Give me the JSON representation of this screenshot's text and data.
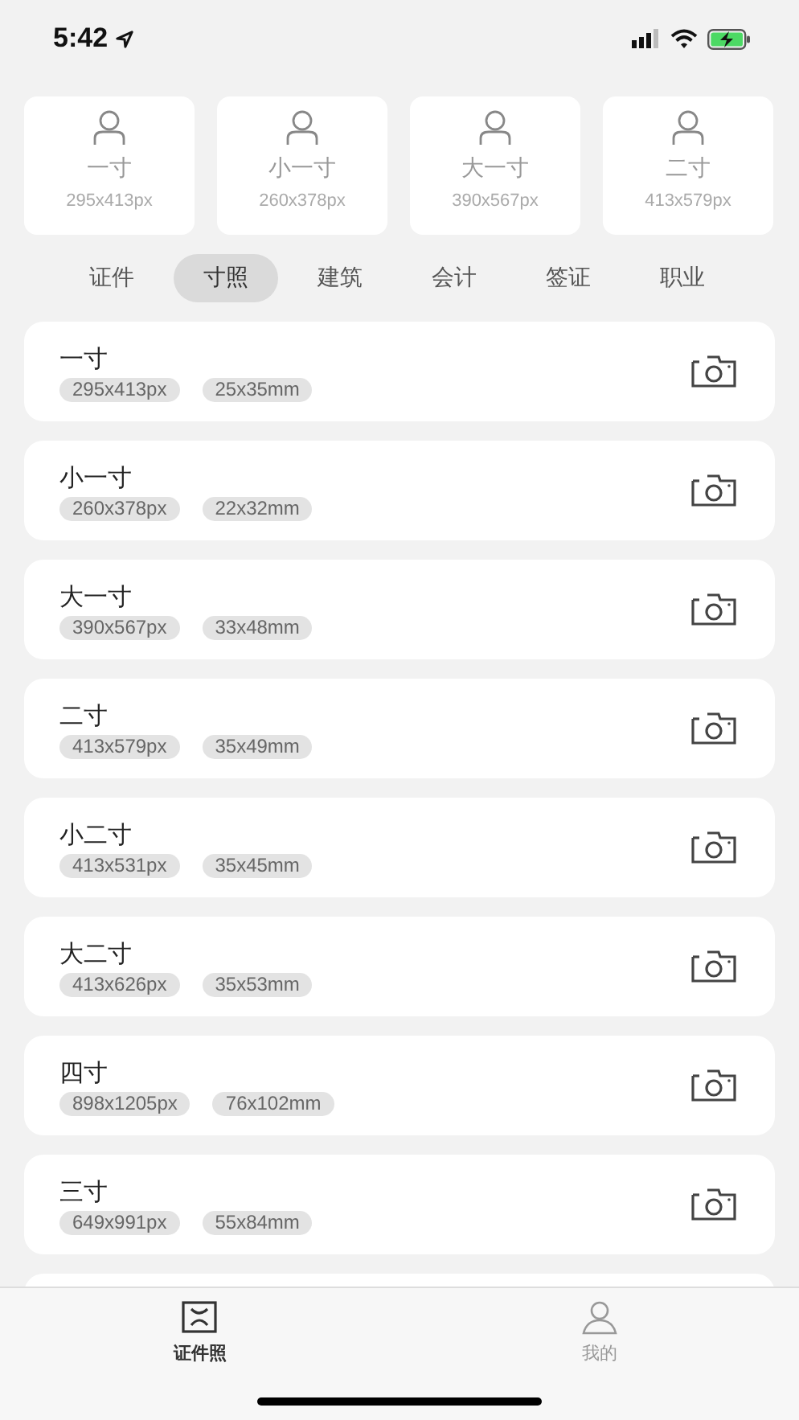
{
  "status_bar": {
    "time": "5:42"
  },
  "featured": [
    {
      "name": "一寸",
      "pixels": "295x413px"
    },
    {
      "name": "小一寸",
      "pixels": "260x378px"
    },
    {
      "name": "大一寸",
      "pixels": "390x567px"
    },
    {
      "name": "二寸",
      "pixels": "413x579px"
    }
  ],
  "categories": [
    {
      "label": "证件",
      "selected": false
    },
    {
      "label": "寸照",
      "selected": true
    },
    {
      "label": "建筑",
      "selected": false
    },
    {
      "label": "会计",
      "selected": false
    },
    {
      "label": "签证",
      "selected": false
    },
    {
      "label": "职业",
      "selected": false
    }
  ],
  "sizes": [
    {
      "name": "一寸",
      "pixels": "295x413px",
      "mm": "25x35mm"
    },
    {
      "name": "小一寸",
      "pixels": "260x378px",
      "mm": "22x32mm"
    },
    {
      "name": "大一寸",
      "pixels": "390x567px",
      "mm": "33x48mm"
    },
    {
      "name": "二寸",
      "pixels": "413x579px",
      "mm": "35x49mm"
    },
    {
      "name": "小二寸",
      "pixels": "413x531px",
      "mm": "35x45mm"
    },
    {
      "name": "大二寸",
      "pixels": "413x626px",
      "mm": "35x53mm"
    },
    {
      "name": "四寸",
      "pixels": "898x1205px",
      "mm": "76x102mm"
    },
    {
      "name": "三寸",
      "pixels": "649x991px",
      "mm": "55x84mm"
    }
  ],
  "tab_bar": [
    {
      "label": "证件照",
      "kind": "photo",
      "selected": true
    },
    {
      "label": "我的",
      "kind": "profile",
      "selected": false
    }
  ]
}
